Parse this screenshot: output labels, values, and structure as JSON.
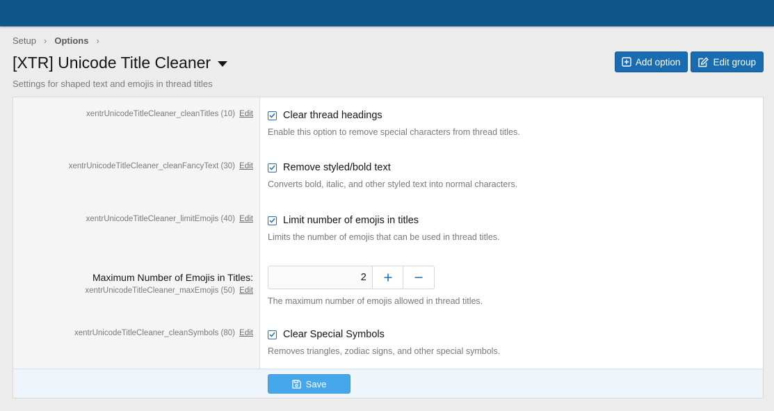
{
  "breadcrumb": {
    "items": [
      "Setup",
      "Options"
    ],
    "separator": "›"
  },
  "page": {
    "title": "[XTR] Unicode Title Cleaner",
    "description": "Settings for shaped text and emojis in thread titles"
  },
  "actions": {
    "add_option": "Add option",
    "edit_group": "Edit group"
  },
  "options": [
    {
      "key": "xentrUnicodeTitleCleaner_cleanTitles (10)",
      "edit": "Edit",
      "label": "Clear thread headings",
      "hint": "Enable this option to remove special characters from thread titles.",
      "checked": true
    },
    {
      "key": "xentrUnicodeTitleCleaner_cleanFancyText (30)",
      "edit": "Edit",
      "label": "Remove styled/bold text",
      "hint": "Converts bold, italic, and other styled text into normal characters.",
      "checked": true
    },
    {
      "key": "xentrUnicodeTitleCleaner_limitEmojis (40)",
      "edit": "Edit",
      "label": "Limit number of emojis in titles",
      "hint": "Limits the number of emojis that can be used in thread titles.",
      "checked": true
    },
    {
      "title": "Maximum Number of Emojis in Titles:",
      "key": "xentrUnicodeTitleCleaner_maxEmojis (50)",
      "edit": "Edit",
      "value": "2",
      "hint": "The maximum number of emojis allowed in thread titles."
    },
    {
      "key": "xentrUnicodeTitleCleaner_cleanSymbols (80)",
      "edit": "Edit",
      "label": "Clear Special Symbols",
      "hint": "Removes triangles, zodiac signs, and other special symbols.",
      "checked": true
    }
  ],
  "footer": {
    "save": "Save"
  },
  "colors": {
    "topbar": "#0f578a",
    "primary_button": "#1a6cb0",
    "save_button": "#47a7eb",
    "checkbox": "#1f6fb4"
  },
  "icons": {
    "add": "plus-square-icon",
    "edit": "edit-pencil-icon",
    "save": "save-floppy-icon",
    "check": "check-icon",
    "caret": "caret-down-icon"
  }
}
